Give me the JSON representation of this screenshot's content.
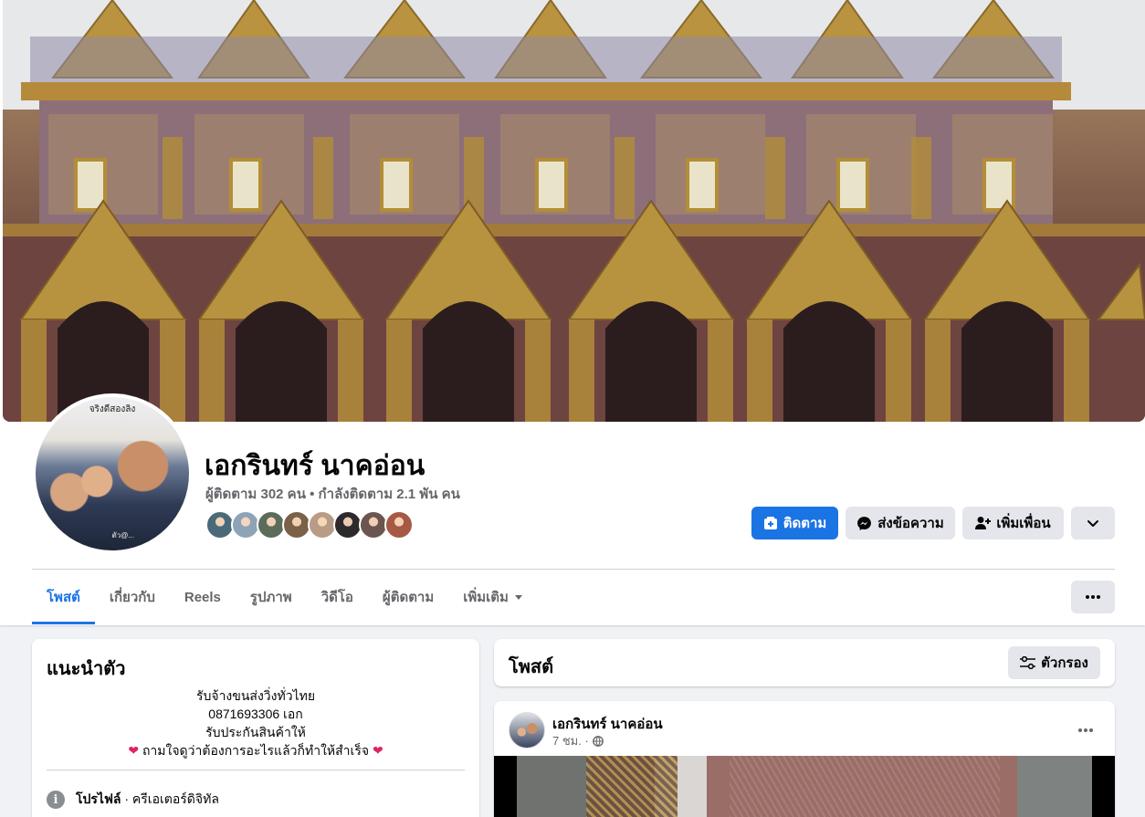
{
  "profile": {
    "name": "เอกรินทร์ นาคอ่อน",
    "stats": "ผู้ติดตาม 302 คน • กำลังติดตาม 2.1 พัน คน",
    "avatar_caption": "จริงดีสองลิง",
    "avatar_watermark": "ตัว@..."
  },
  "friend_avatar_colors": [
    "#4a6a7a",
    "#8fa3b6",
    "#5b6c5a",
    "#7a6148",
    "#b89c86",
    "#2d2a2e",
    "#6b5550",
    "#a55a45"
  ],
  "actions": {
    "follow": "ติดตาม",
    "message": "ส่งข้อความ",
    "add_friend": "เพิ่มเพื่อน"
  },
  "tabs": [
    {
      "label": "โพสต์"
    },
    {
      "label": "เกี่ยวกับ"
    },
    {
      "label": "Reels"
    },
    {
      "label": "รูปภาพ"
    },
    {
      "label": "วิดีโอ"
    },
    {
      "label": "ผู้ติดตาม"
    },
    {
      "label": "เพิ่มเติม"
    }
  ],
  "intro": {
    "title": "แนะนำตัว",
    "bio": [
      "รับจ้างขนส่งวิ่งทั่วไทย",
      "0871693306 เอก",
      "รับประกันสินค้าให้",
      "ถามใจดูว่าต้องการอะไรแล้วก็ทำให้สำเร็จ"
    ],
    "profile_label": "โปรไฟล์",
    "profile_category": " · ครีเอเตอร์ดิจิทัล"
  },
  "posts": {
    "title": "โพสต์",
    "filter": "ตัวกรอง"
  },
  "post": {
    "author": "เอกรินทร์ นาคอ่อน",
    "time": "7 ชม. ·"
  },
  "colors": {
    "accent": "#1b74e4",
    "button_gray": "#e4e6eb",
    "page_bg": "#f0f2f5"
  }
}
